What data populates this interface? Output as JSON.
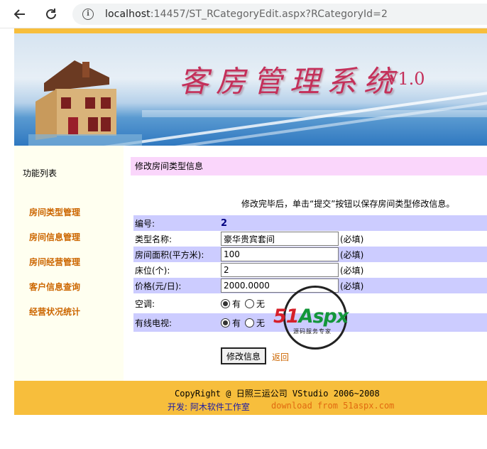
{
  "browser": {
    "url_host": "localhost",
    "url_rest": ":14457/ST_RCategoryEdit.aspx?RCategoryId=2"
  },
  "banner": {
    "title": "客房管理系统",
    "version": "V1.0"
  },
  "sidebar": {
    "heading": "功能列表",
    "items": [
      {
        "label": "房间类型管理"
      },
      {
        "label": "房间信息管理"
      },
      {
        "label": "房间经营管理"
      },
      {
        "label": "客户信息查询"
      },
      {
        "label": "经营状况统计"
      }
    ]
  },
  "main": {
    "section_title": "修改房间类型信息",
    "hint": "修改完毕后，单击“提交”按钮以保存房间类型修改信息。",
    "form": {
      "id_label": "编号:",
      "id_value": "2",
      "name_label": "类型名称:",
      "name_value": "豪华贵宾套间",
      "area_label": "房间面积(平方米):",
      "area_value": "100",
      "beds_label": "床位(个):",
      "beds_value": "2",
      "price_label": "价格(元/日):",
      "price_value": "2000.0000",
      "required": "(必填)",
      "ac_label": "空调:",
      "tv_label": "有线电视:",
      "yes": "有",
      "no": "无",
      "ac_selected": "有",
      "tv_selected": "有"
    },
    "submit_label": "修改信息",
    "back_label": "返回"
  },
  "watermark": {
    "brand_red": "51",
    "brand_green": "Aspx",
    "tagline": "源码服务专家"
  },
  "footer": {
    "copyright": "CopyRight @ 日照三运公司 VStudio 2006~2008",
    "developer": "开发: 阿木软件工作室",
    "download": "download from 51aspx.com"
  },
  "colors": {
    "accent_orange": "#f7be3c",
    "link": "#cc6600",
    "row_shade": "#ccccff",
    "title_bg": "#fad6fb"
  }
}
